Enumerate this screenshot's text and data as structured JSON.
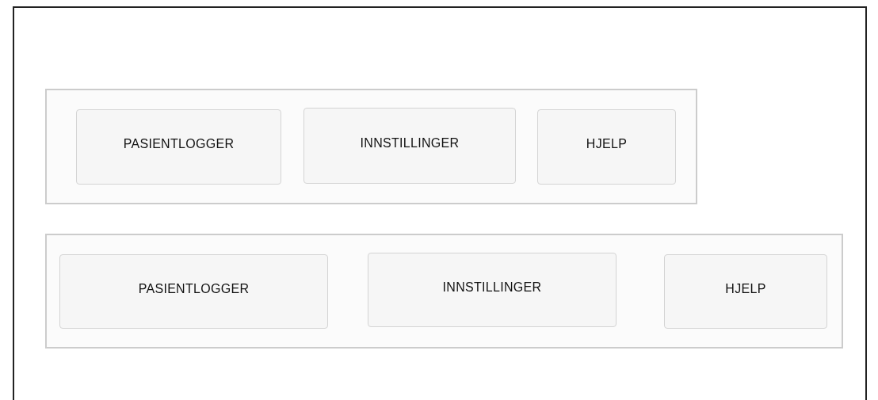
{
  "nav_bars": [
    {
      "buttons": [
        {
          "label": "PASIENTLOGGER"
        },
        {
          "label": "INNSTILLINGER"
        },
        {
          "label": "HJELP"
        }
      ]
    },
    {
      "buttons": [
        {
          "label": "PASIENTLOGGER"
        },
        {
          "label": "INNSTILLINGER"
        },
        {
          "label": "HJELP"
        }
      ]
    }
  ]
}
